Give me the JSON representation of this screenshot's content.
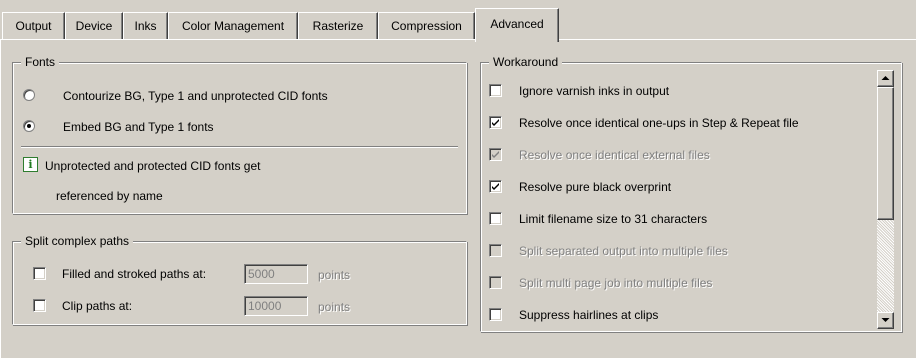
{
  "tabs": [
    {
      "label": "Output"
    },
    {
      "label": "Device"
    },
    {
      "label": "Inks"
    },
    {
      "label": "Color Management"
    },
    {
      "label": "Rasterize"
    },
    {
      "label": "Compression"
    },
    {
      "label": "Advanced",
      "active": true
    }
  ],
  "fonts": {
    "title": "Fonts",
    "options": [
      {
        "label": "Contourize BG, Type 1 and unprotected CID fonts",
        "selected": false
      },
      {
        "label": "Embed BG and Type 1 fonts",
        "selected": true
      }
    ],
    "info_line1": "Unprotected and protected CID fonts get",
    "info_line2": "referenced by name",
    "info_icon": "info-icon"
  },
  "split": {
    "title": "Split complex paths",
    "rows": [
      {
        "label": "Filled and stroked paths at:",
        "checked": false,
        "value": "5000",
        "unit": "points"
      },
      {
        "label": "Clip paths at:",
        "checked": false,
        "value": "10000",
        "unit": "points"
      }
    ]
  },
  "workaround": {
    "title": "Workaround",
    "items": [
      {
        "label": "Ignore varnish inks in output",
        "checked": false,
        "enabled": true
      },
      {
        "label": "Resolve once identical one-ups in Step & Repeat file",
        "checked": true,
        "enabled": true
      },
      {
        "label": "Resolve once identical external files",
        "checked": true,
        "enabled": false
      },
      {
        "label": "Resolve pure black overprint",
        "checked": true,
        "enabled": true
      },
      {
        "label": "Limit filename size to 31 characters",
        "checked": false,
        "enabled": true
      },
      {
        "label": "Split separated output into multiple files",
        "checked": false,
        "enabled": false
      },
      {
        "label": "Split multi page job into multiple files",
        "checked": false,
        "enabled": false
      },
      {
        "label": "Suppress hairlines at clips",
        "checked": false,
        "enabled": true
      }
    ]
  },
  "colors": {
    "face": "#d4d0c8",
    "disabled_text": "#808080",
    "info_green": "#1f7a1f"
  }
}
